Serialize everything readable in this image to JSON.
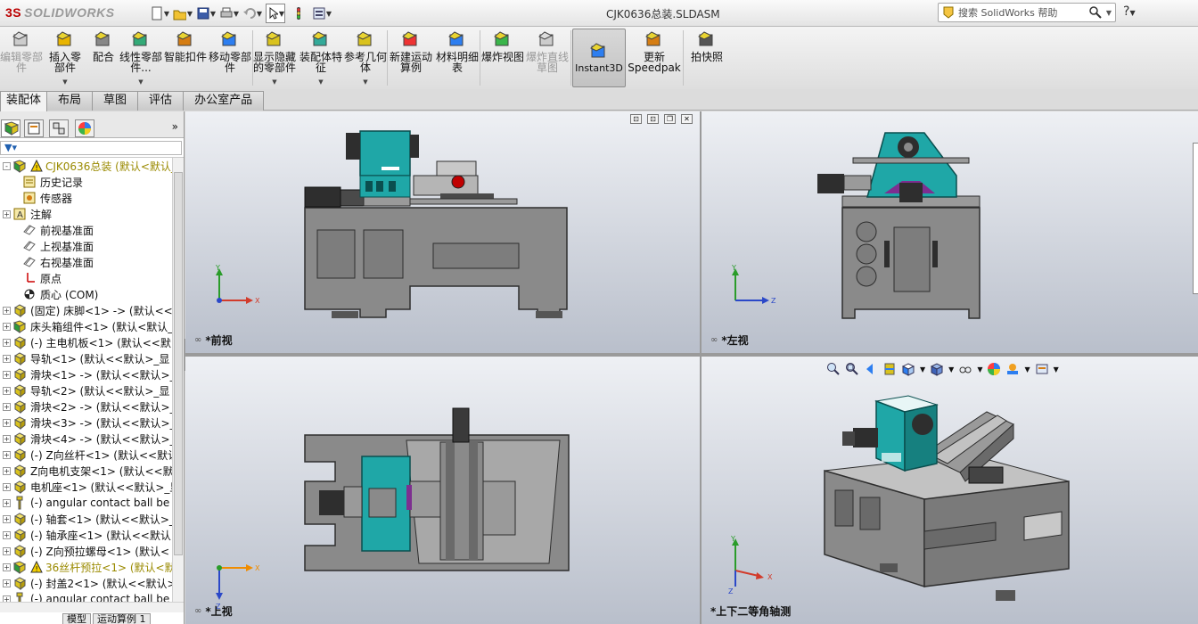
{
  "app": {
    "logo_text": "SOLIDWORKS",
    "logo_mark": "3S",
    "document_title": "CJK0636总装.SLDASM"
  },
  "search": {
    "placeholder": "搜索 SolidWorks 帮助",
    "help_glyph": "?"
  },
  "quick_toolbar": [
    "new-icon",
    "open-icon",
    "save-icon",
    "print-icon",
    "undo-icon",
    "select-icon",
    "rebuild-icon",
    "options-icon"
  ],
  "commands": [
    {
      "label": "编辑零部件",
      "disabled": true
    },
    {
      "label": "插入零部件",
      "disabled": false
    },
    {
      "label": "配合",
      "disabled": false
    },
    {
      "label": "线性零部件...",
      "disabled": false
    },
    {
      "label": "智能扣件",
      "disabled": false
    },
    {
      "label": "移动零部件",
      "disabled": false
    },
    {
      "label": "显示隐藏的零部件",
      "disabled": false
    },
    {
      "label": "装配体特征",
      "disabled": false
    },
    {
      "label": "参考几何体",
      "disabled": false
    },
    {
      "label": "新建运动算例",
      "disabled": false
    },
    {
      "label": "材料明细表",
      "disabled": false
    },
    {
      "label": "爆炸视图",
      "disabled": false
    },
    {
      "label": "爆炸直线草图",
      "disabled": true
    },
    {
      "label": "Instant3D",
      "disabled": false
    },
    {
      "label": "更新Speedpak",
      "disabled": false
    },
    {
      "label": "拍快照",
      "disabled": false
    }
  ],
  "tabs": [
    "装配体",
    "布局",
    "草图",
    "评估",
    "办公室产品"
  ],
  "panel": {
    "expand_glyph": "»",
    "bottom_tabs": [
      "模型",
      "运动算例 1"
    ],
    "tree": [
      {
        "label": "CJK0636总装 (默认<默认_显",
        "icon": "assembly-icon",
        "exp": "-",
        "warn": true
      },
      {
        "label": "历史记录",
        "icon": "history-icon",
        "exp": ""
      },
      {
        "label": "传感器",
        "icon": "sensor-icon",
        "exp": ""
      },
      {
        "label": "注解",
        "icon": "annotation-icon",
        "exp": "+"
      },
      {
        "label": "前视基准面",
        "icon": "plane-icon",
        "exp": ""
      },
      {
        "label": "上视基准面",
        "icon": "plane-icon",
        "exp": ""
      },
      {
        "label": "右视基准面",
        "icon": "plane-icon",
        "exp": ""
      },
      {
        "label": "原点",
        "icon": "origin-icon",
        "exp": ""
      },
      {
        "label": "质心 (COM)",
        "icon": "com-icon",
        "exp": ""
      },
      {
        "label": "(固定) 床脚<1> -> (默认<<",
        "icon": "part-icon",
        "exp": "+"
      },
      {
        "label": "床头箱组件<1> (默认<默认_",
        "icon": "subassembly-icon",
        "exp": "+"
      },
      {
        "label": "(-) 主电机板<1> (默认<<默",
        "icon": "part-icon",
        "exp": "+"
      },
      {
        "label": "导轨<1> (默认<<默认>_显",
        "icon": "part-icon",
        "exp": "+"
      },
      {
        "label": "滑块<1> -> (默认<<默认>_",
        "icon": "part-icon",
        "exp": "+"
      },
      {
        "label": "导轨<2> (默认<<默认>_显",
        "icon": "part-icon",
        "exp": "+"
      },
      {
        "label": "滑块<2> -> (默认<<默认>_",
        "icon": "part-icon",
        "exp": "+"
      },
      {
        "label": "滑块<3> -> (默认<<默认>_",
        "icon": "part-icon",
        "exp": "+"
      },
      {
        "label": "滑块<4> -> (默认<<默认>_",
        "icon": "part-icon",
        "exp": "+"
      },
      {
        "label": "(-) Z向丝杆<1> (默认<<默认",
        "icon": "part-icon",
        "exp": "+"
      },
      {
        "label": "Z向电机支架<1> (默认<<默",
        "icon": "part-icon",
        "exp": "+"
      },
      {
        "label": "电机座<1> (默认<<默认>_显",
        "icon": "part-icon",
        "exp": "+"
      },
      {
        "label": "(-) angular contact ball be",
        "icon": "toolbox-icon",
        "exp": "+"
      },
      {
        "label": "(-) 轴套<1> (默认<<默认>_",
        "icon": "part-icon",
        "exp": "+"
      },
      {
        "label": "(-) 轴承座<1> (默认<<默认",
        "icon": "part-icon",
        "exp": "+"
      },
      {
        "label": "(-) Z向预拉螺母<1> (默认<",
        "icon": "part-icon",
        "exp": "+"
      },
      {
        "label": "36丝杆预拉<1> (默认<默",
        "icon": "subassembly-icon",
        "exp": "+",
        "warn": true
      },
      {
        "label": "(-) 封盖2<1> (默认<<默认>",
        "icon": "part-icon",
        "exp": "+"
      },
      {
        "label": "(-) angular contact ball be",
        "icon": "toolbox-icon",
        "exp": "+"
      }
    ]
  },
  "viewports": [
    {
      "label": "*前视",
      "axes": [
        "Y",
        "X"
      ]
    },
    {
      "label": "*左视",
      "axes": [
        "Y",
        "Z"
      ]
    },
    {
      "label": "*上视",
      "axes": [
        "X",
        "Z"
      ]
    },
    {
      "label": "*上下二等角轴测",
      "axes": [
        "Y",
        "X",
        "Z"
      ]
    }
  ],
  "colors": {
    "model_gray": "#8a8a8a",
    "model_teal": "#1fa7a7",
    "model_dark": "#2e2e2e",
    "accent_red": "#c00000",
    "axis_x": "#d23b2b",
    "axis_y": "#2a9c2a",
    "axis_z": "#2b48c8"
  }
}
